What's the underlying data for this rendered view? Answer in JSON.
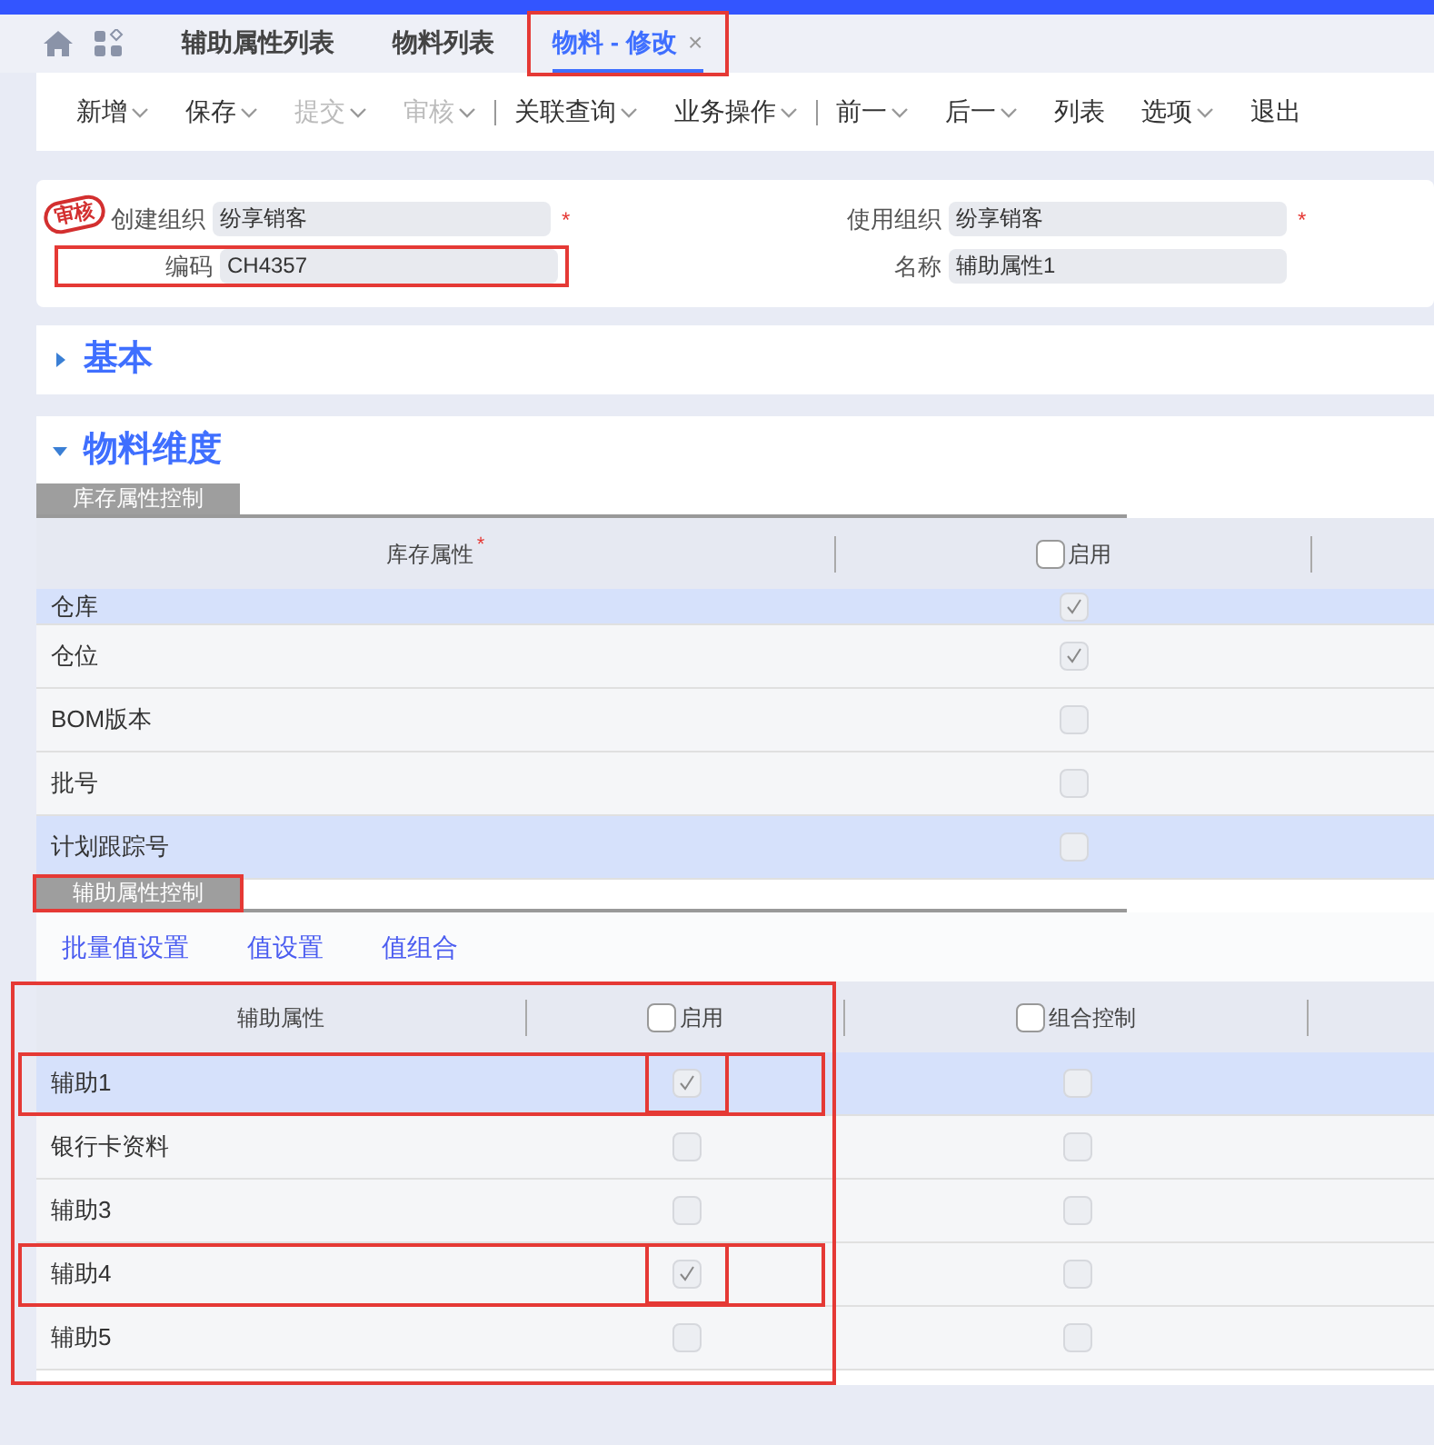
{
  "tabs": [
    {
      "label": "辅助属性列表",
      "selected": false,
      "closable": false,
      "highlighted": false
    },
    {
      "label": "物料列表",
      "selected": false,
      "closable": false,
      "highlighted": false
    },
    {
      "label": "物料 - 修改",
      "selected": true,
      "closable": true,
      "close": "×",
      "highlighted": true
    }
  ],
  "toolbar": [
    {
      "label": "新增",
      "dropdown": true,
      "disabled": false,
      "separator_after": false
    },
    {
      "label": "保存",
      "dropdown": true,
      "disabled": false,
      "separator_after": false
    },
    {
      "label": "提交",
      "dropdown": true,
      "disabled": true,
      "separator_after": false
    },
    {
      "label": "审核",
      "dropdown": true,
      "disabled": true,
      "separator_after": true
    },
    {
      "label": "关联查询",
      "dropdown": true,
      "disabled": false,
      "separator_after": false
    },
    {
      "label": "业务操作",
      "dropdown": true,
      "disabled": false,
      "separator_after": true
    },
    {
      "label": "前一",
      "dropdown": true,
      "disabled": false,
      "separator_after": false
    },
    {
      "label": "后一",
      "dropdown": true,
      "disabled": false,
      "separator_after": false
    },
    {
      "label": "列表",
      "dropdown": false,
      "disabled": false,
      "separator_after": false
    },
    {
      "label": "选项",
      "dropdown": true,
      "disabled": false,
      "separator_after": false
    },
    {
      "label": "退出",
      "dropdown": false,
      "disabled": false,
      "separator_after": false
    }
  ],
  "form": {
    "stamp": "审核",
    "fields": [
      {
        "label": "创建组织",
        "value": "纷享销客",
        "required_mark": "*",
        "highlighted": false
      },
      {
        "label": "使用组织",
        "value": "纷享销客",
        "required_mark": "*",
        "highlighted": false
      },
      {
        "label": "编码",
        "value": "CH4357",
        "highlighted": true
      },
      {
        "label": "名称",
        "value": "辅助属性1",
        "highlighted": false
      }
    ]
  },
  "sections": [
    {
      "title": "基本",
      "expanded": false
    },
    {
      "title": "物料维度",
      "expanded": true
    }
  ],
  "stock_control": {
    "tab": "库存属性控制",
    "columns": [
      {
        "label": "库存属性",
        "required_mark": "*"
      },
      {
        "label": "启用",
        "checked": false
      }
    ],
    "rows": [
      {
        "name": "仓库",
        "selected": true,
        "enabled": true
      },
      {
        "name": "仓位",
        "selected": false,
        "enabled": true
      },
      {
        "name": "BOM版本",
        "selected": false,
        "enabled": false
      },
      {
        "name": "批号",
        "selected": false,
        "enabled": false
      },
      {
        "name": "计划跟踪号",
        "selected": true,
        "enabled": false
      }
    ]
  },
  "aux_control": {
    "tab": "辅助属性控制",
    "tab_highlighted": true,
    "links": [
      "批量值设置",
      "值设置",
      "值组合"
    ],
    "table_highlighted": true,
    "columns": [
      {
        "label": "辅助属性"
      },
      {
        "label": "启用",
        "checked": false
      },
      {
        "label": "组合控制",
        "checked": false
      }
    ],
    "rows": [
      {
        "name": "辅助1",
        "selected": true,
        "enabled": true,
        "combined": false,
        "highlighted": true
      },
      {
        "name": "银行卡资料",
        "selected": false,
        "enabled": false,
        "combined": false,
        "highlighted": false
      },
      {
        "name": "辅助3",
        "selected": false,
        "enabled": false,
        "combined": false,
        "highlighted": false
      },
      {
        "name": "辅助4",
        "selected": false,
        "enabled": true,
        "combined": false,
        "highlighted": true
      },
      {
        "name": "辅助5",
        "selected": false,
        "enabled": false,
        "combined": false,
        "highlighted": false
      }
    ]
  }
}
